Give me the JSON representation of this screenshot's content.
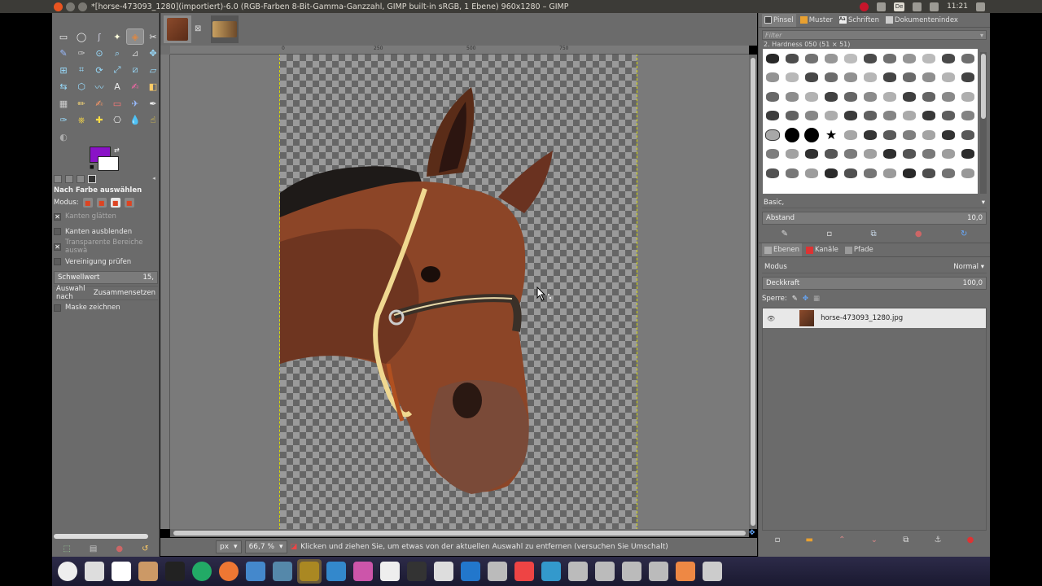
{
  "window": {
    "title": "*[horse-473093_1280](importiert)-6.0 (RGB-Farben 8-Bit-Gamma-Ganzzahl, GIMP built-in sRGB, 1 Ebene) 960x1280 – GIMP"
  },
  "tray": {
    "keyboard": "De",
    "time": "11:21"
  },
  "toolbox": {
    "tools": [
      "rect-select",
      "ellipse-select",
      "free-select",
      "fuzzy-select",
      "select-by-color",
      "scissors",
      "foreground-select",
      "paths",
      "color-picker",
      "zoom",
      "measure",
      "move",
      "align",
      "crop",
      "rotate",
      "scale",
      "shear",
      "perspective",
      "flip",
      "cage",
      "warp",
      "text",
      "paint",
      "bucket-fill",
      "blend",
      "pencil",
      "paintbrush",
      "eraser",
      "airbrush",
      "ink",
      "myPaint",
      "clone",
      "heal",
      "perspective-clone",
      "blur",
      "smudge",
      "dodge"
    ],
    "active_tool_index": 4,
    "fg_color": "#8a12c7",
    "bg_color": "#ffffff",
    "options_title": "Nach Farbe auswählen",
    "mode_label": "Modus:",
    "options": [
      {
        "label": "Kanten glätten",
        "checked": true,
        "dim": true
      },
      {
        "label": "Kanten ausblenden",
        "checked": false,
        "dim": false
      },
      {
        "label": "Transparente Bereiche auswä",
        "checked": true,
        "dim": true
      },
      {
        "label": "Vereinigung prüfen",
        "checked": false,
        "dim": false
      }
    ],
    "threshold_label": "Schwellwert",
    "threshold_value": "15,",
    "select_by_label": "Auswahl nach",
    "select_by_value": "Zusammensetzen",
    "draw_mask_label": "Maske zeichnen"
  },
  "ruler_ticks": [
    "0",
    "250",
    "500",
    "750"
  ],
  "statusbar": {
    "unit": "px",
    "zoom": "66,7 %",
    "message": "Klicken und ziehen Sie, um etwas von der aktuellen Auswahl zu entfernen (versuchen Sie Umschalt)"
  },
  "brushes_panel": {
    "tabs": [
      "Pinsel",
      "Muster",
      "Schriften",
      "Dokumentenindex"
    ],
    "filter_placeholder": "Filter",
    "brush_name": "2. Hardness 050 (51 × 51)",
    "preset": "Basic,",
    "spacing_label": "Abstand",
    "spacing_value": "10,0"
  },
  "layers_panel": {
    "tabs": [
      "Ebenen",
      "Kanäle",
      "Pfade"
    ],
    "mode_label": "Modus",
    "mode_value": "Normal",
    "opacity_label": "Deckkraft",
    "opacity_value": "100,0",
    "lock_label": "Sperre:",
    "layers": [
      {
        "name": "horse-473093_1280.jpg",
        "visible": true
      }
    ]
  },
  "dock": [
    "dash",
    "screenshot",
    "inkscape",
    "files",
    "terminal",
    "chrome",
    "firefox",
    "thunderbird",
    "tool",
    "gimp",
    "editor",
    "color-app",
    "inkscape2",
    "picker",
    "printer",
    "writer",
    "trash-doc",
    "settings",
    "monitor",
    "drive1",
    "drive2",
    "drive3",
    "drive4",
    "software-center",
    "trash"
  ]
}
